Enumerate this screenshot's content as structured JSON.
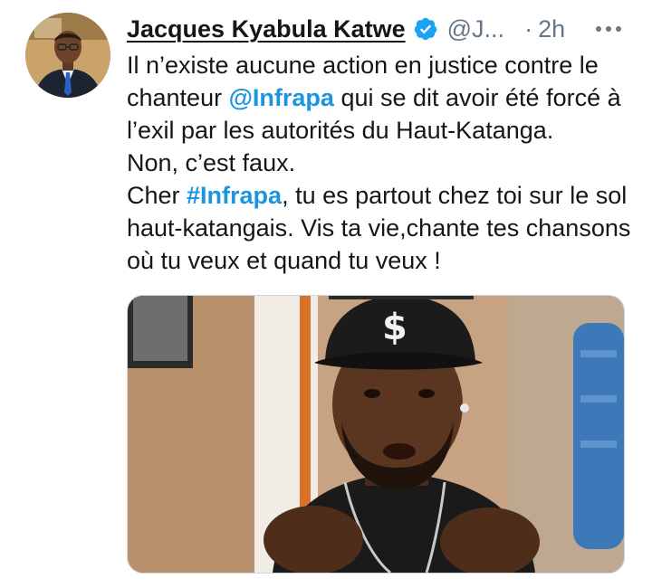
{
  "author": {
    "display_name": "Jacques Kyabula Katwe",
    "handle": "@J...",
    "separator": "·",
    "timestamp": "2h",
    "verified": true,
    "avatar_icon": "profile-photo"
  },
  "more_icon": "more-horizontal-icon",
  "tweet": {
    "line1_pre": "Il n’existe aucune action en justice contre le chanteur ",
    "mention": "@Infrapa",
    "line1_post": " qui se dit avoir été forcé à l’exil par les autorités du Haut-Katanga.",
    "line2": "Non, c’est faux.",
    "line3_pre": "Cher ",
    "hashtag": "#Infrapa",
    "line3_post": ", tu es partout chez toi sur le sol haut-katangais. Vis ta vie,chante tes chansons où tu veux et quand tu veux !"
  },
  "media": {
    "cap_symbol": "$",
    "description_icon": "photo-man-in-cap"
  },
  "colors": {
    "link": "#1b95e0",
    "secondary_text": "#657786",
    "verified_badge": "#1da1f2"
  }
}
